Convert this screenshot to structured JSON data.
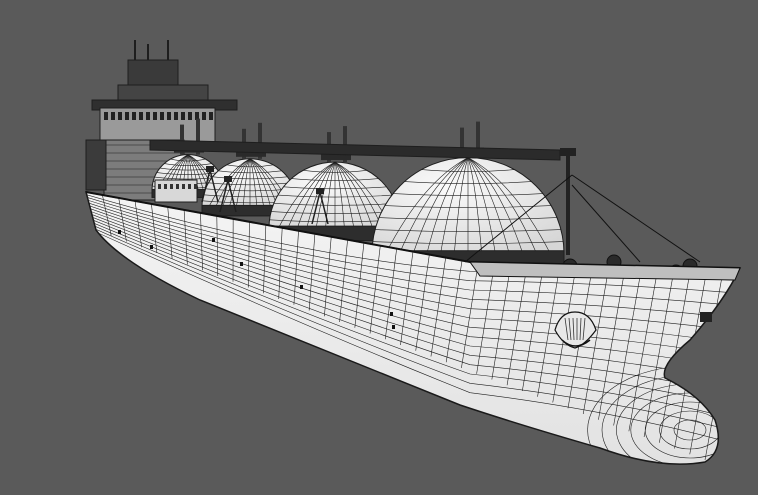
{
  "scene": {
    "subject": "lng-carrier-ship-wireframe",
    "background_color": "#5a5a5a",
    "hull_color": "#f2f2f2",
    "hull_shade_color": "#d9d9d9",
    "wire_color": "#1e1e1e",
    "tank_color": "#eeeeee",
    "tank_count": 4
  }
}
